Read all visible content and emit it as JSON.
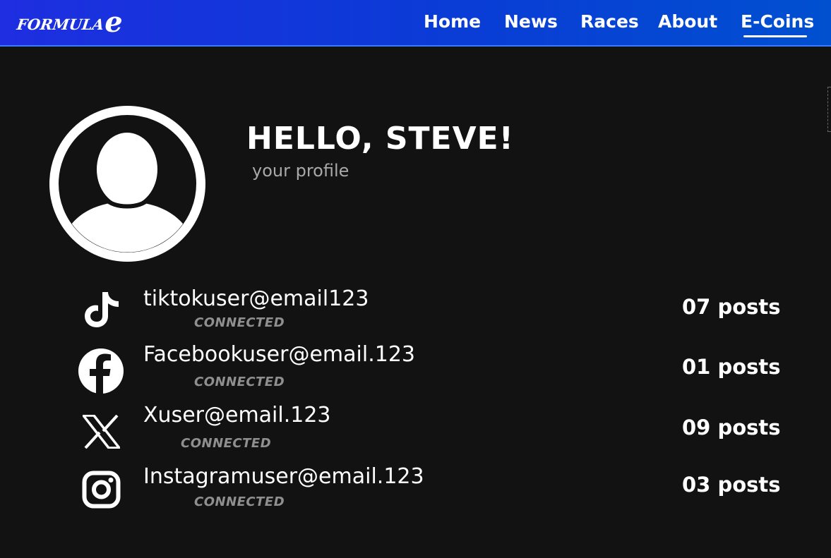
{
  "brand": {
    "logo_text": "FORMULA",
    "logo_mark": "e"
  },
  "nav": {
    "items": [
      {
        "label": "Home",
        "active": false
      },
      {
        "label": "News",
        "active": false
      },
      {
        "label": "Races",
        "active": false
      },
      {
        "label": "About",
        "active": false
      },
      {
        "label": "E-Coins",
        "active": true
      }
    ]
  },
  "profile": {
    "greeting": "HELLO, STEVE!",
    "subtitle": "your profile",
    "avatar_icon": "user-avatar-icon"
  },
  "accounts": [
    {
      "platform": "tiktok",
      "icon": "tiktok-icon",
      "email": "tiktokuser@email123",
      "status": "CONNECTED",
      "posts": "07 posts"
    },
    {
      "platform": "facebook",
      "icon": "facebook-icon",
      "email": "Facebookuser@email.123",
      "status": "CONNECTED",
      "posts": "01 posts"
    },
    {
      "platform": "x",
      "icon": "x-icon",
      "email": "Xuser@email.123",
      "status": "CONNECTED",
      "posts": "09 posts"
    },
    {
      "platform": "instagram",
      "icon": "instagram-icon",
      "email": "Instagramuser@email.123",
      "status": "CONNECTED",
      "posts": "03 posts"
    }
  ],
  "colors": {
    "background": "#121212",
    "nav_gradient_start": "#1e2ee0",
    "nav_gradient_end": "#0050d0",
    "text_primary": "#ffffff",
    "text_muted": "#a9a9a9",
    "status_gray": "#8f8f8f"
  }
}
